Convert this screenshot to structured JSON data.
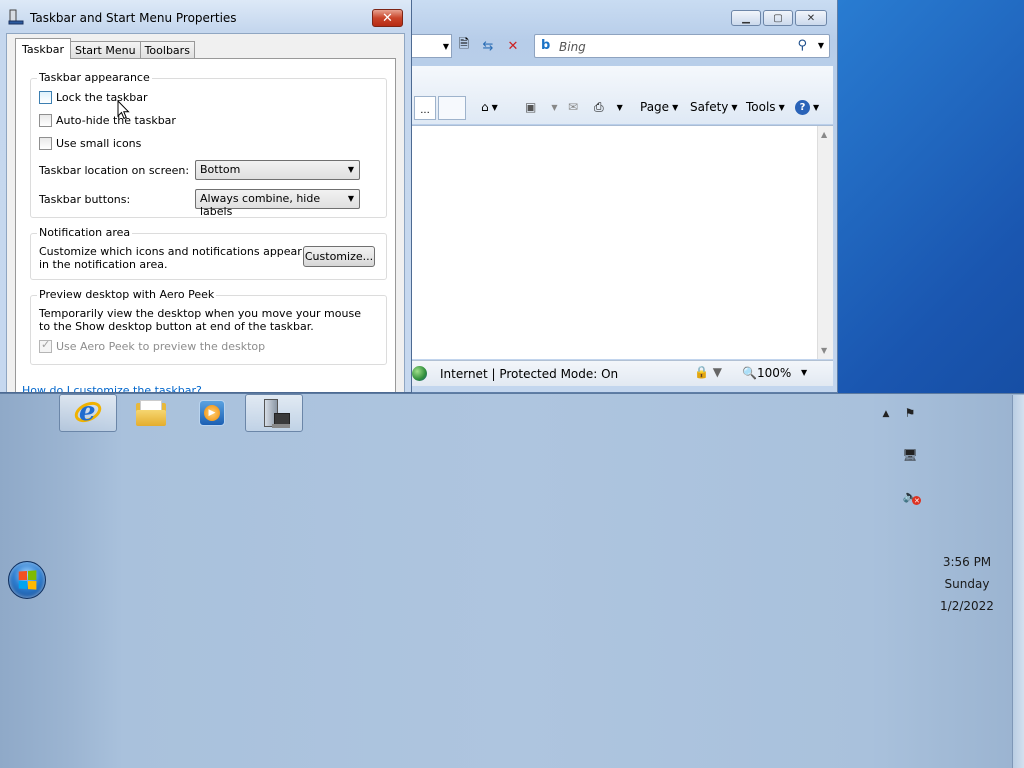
{
  "ie": {
    "search_placeholder": "Bing",
    "cmd_tab_stub": "...",
    "cmd_page": "Page",
    "cmd_safety": "Safety",
    "cmd_tools": "Tools",
    "status_zone": "Internet | Protected Mode: On",
    "zoom": "100%"
  },
  "dialog": {
    "title": "Taskbar and Start Menu Properties",
    "close_label": "✕",
    "tabs": [
      {
        "label": "Taskbar",
        "active": true
      },
      {
        "label": "Start Menu",
        "active": false
      },
      {
        "label": "Toolbars",
        "active": false
      }
    ],
    "appearance": {
      "title": "Taskbar appearance",
      "lock_label": "Lock the taskbar",
      "lock_checked": false,
      "autohide_label": "Auto-hide the taskbar",
      "autohide_checked": false,
      "small_icons_label": "Use small icons",
      "small_icons_checked": false,
      "location_label": "Taskbar location on screen:",
      "location_value": "Bottom",
      "buttons_label": "Taskbar buttons:",
      "buttons_value": "Always combine, hide labels"
    },
    "notification": {
      "title": "Notification area",
      "description": "Customize which icons and notifications appear in the notification area.",
      "customize_button": "Customize..."
    },
    "aero_peek": {
      "title": "Preview desktop with Aero Peek",
      "description": "Temporarily view the desktop when you move your mouse to the Show desktop button at end of the taskbar.",
      "checkbox_label": "Use Aero Peek to preview the desktop",
      "checkbox_checked": true,
      "checkbox_disabled": true
    },
    "help_link": "How do I customize the taskbar?"
  },
  "taskbar": {
    "position": "top-right docked area of screen bottom",
    "buttons": [
      {
        "name": "internet-explorer",
        "active": true
      },
      {
        "name": "windows-explorer",
        "active": false
      },
      {
        "name": "windows-media-player",
        "active": false
      },
      {
        "name": "server-manager",
        "active": true
      }
    ],
    "clock": {
      "time": "3:56 PM",
      "day": "Sunday",
      "date": "1/2/2022"
    }
  },
  "colors": {
    "desktop_blue": "#1f5fb8",
    "taskbar": "#aec5df",
    "link": "#0066cc",
    "close_red": "#c9452a"
  }
}
